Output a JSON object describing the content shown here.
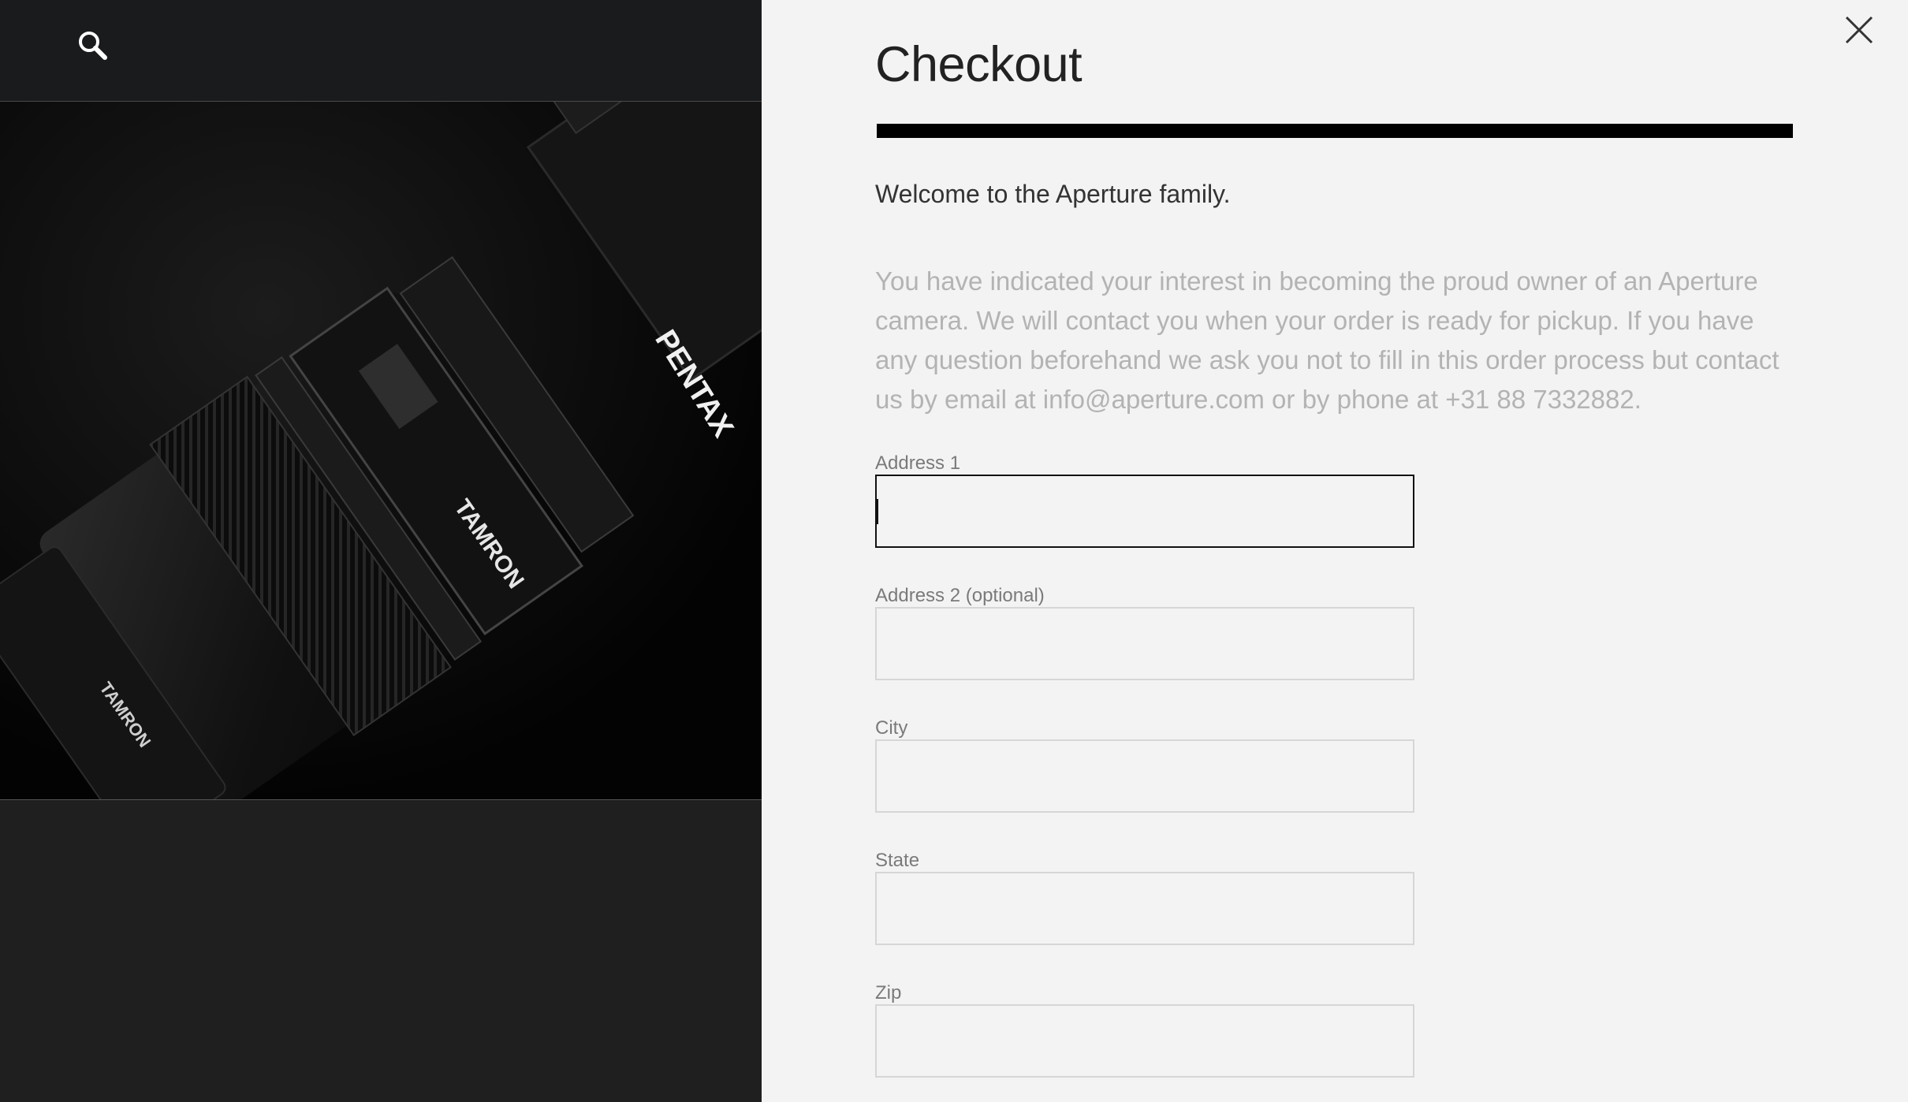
{
  "icons": {
    "search": "search-icon",
    "close": "close-icon"
  },
  "checkout": {
    "title": "Checkout",
    "progress": 1.0,
    "welcome": "Welcome to the Aperture family.",
    "intro": "You have indicated your interest in becoming the proud owner of an Aperture camera. We will contact you when your order is ready for pickup. If you have any question beforehand we ask you not to fill in this order process but contact us by email at info@aperture.com or by phone at +31 88 7332882."
  },
  "form": {
    "fields": [
      {
        "label": "Address 1",
        "value": ""
      },
      {
        "label": "Address 2 (optional)",
        "value": ""
      },
      {
        "label": "City",
        "value": ""
      },
      {
        "label": "State",
        "value": ""
      },
      {
        "label": "Zip",
        "value": ""
      }
    ]
  },
  "hero": {
    "camera_brand_text": "PENTAX",
    "lens_brand_text": "TAMRON"
  }
}
